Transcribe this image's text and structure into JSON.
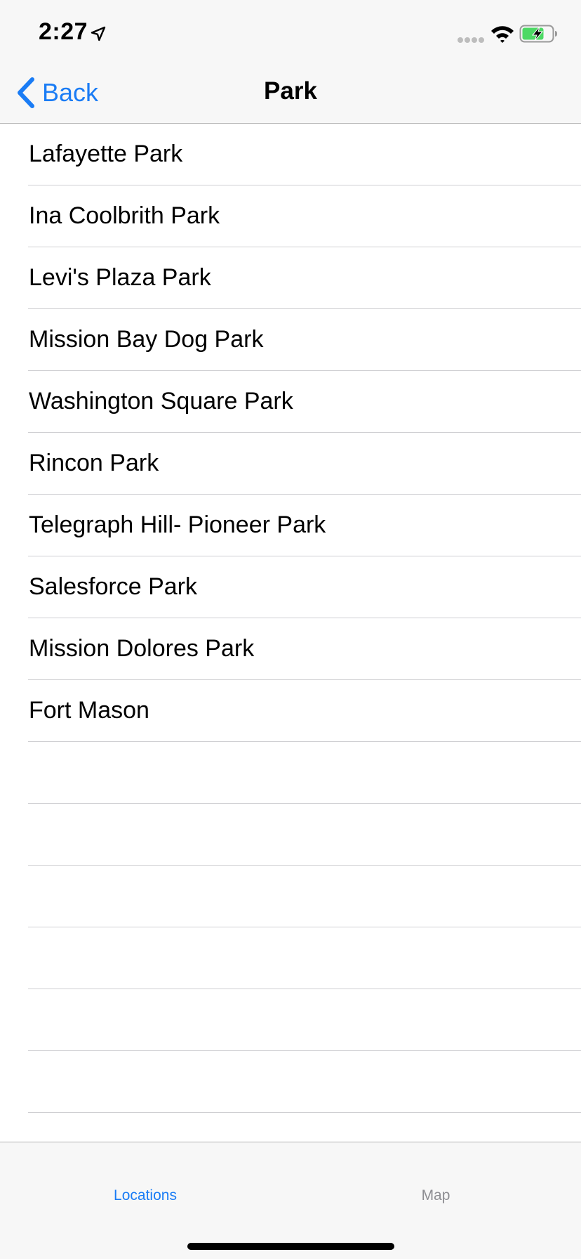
{
  "status_bar": {
    "time": "2:27",
    "icons": [
      "location-arrow-icon",
      "signal-dots-icon",
      "wifi-icon",
      "battery-charging-icon"
    ],
    "battery_color": "#4cd964"
  },
  "nav": {
    "back_label": "Back",
    "title": "Park",
    "accent_color": "#1a7cf5"
  },
  "list": {
    "items": [
      "Lafayette Park",
      "Ina Coolbrith Park",
      "Levi's Plaza Park",
      "Mission Bay Dog Park",
      "Washington Square Park",
      "Rincon Park",
      "Telegraph Hill- Pioneer Park",
      "Salesforce Park",
      "Mission Dolores Park",
      "Fort Mason"
    ],
    "empty_rows": 7
  },
  "tab_bar": {
    "tabs": [
      {
        "label": "Locations",
        "selected": true
      },
      {
        "label": "Map",
        "selected": false
      }
    ]
  }
}
